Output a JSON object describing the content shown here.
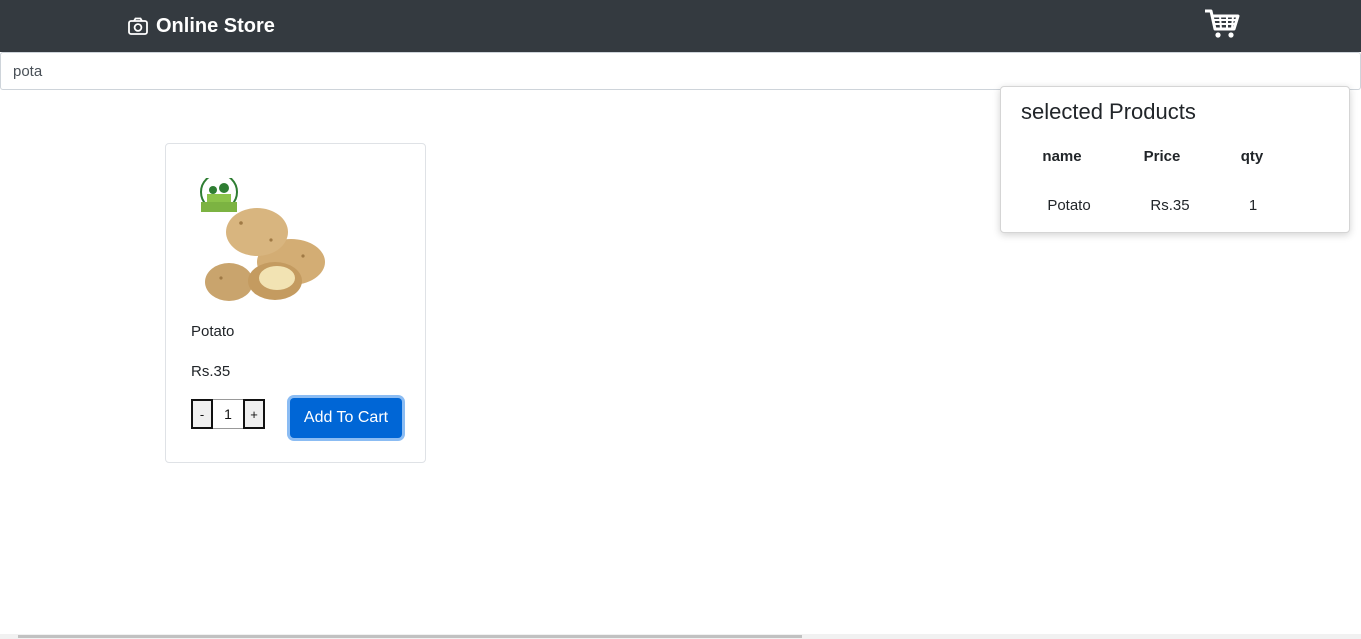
{
  "navbar": {
    "brand": "Online Store",
    "brand_icon": "camera-icon",
    "cart_icon": "shopping-cart-icon"
  },
  "search": {
    "value": "pota"
  },
  "products": [
    {
      "name": "Potato",
      "price": "Rs.35",
      "quantity": "1",
      "decrement_label": "-",
      "increment_label": "+",
      "add_label": "Add To Cart"
    }
  ],
  "cart_panel": {
    "title": "selected Products",
    "columns": [
      "name",
      "Price",
      "qty"
    ],
    "rows": [
      [
        "Potato",
        "Rs.35",
        "1"
      ]
    ]
  },
  "colors": {
    "navbar": "#343a40",
    "primary_button": "#0066d6"
  }
}
